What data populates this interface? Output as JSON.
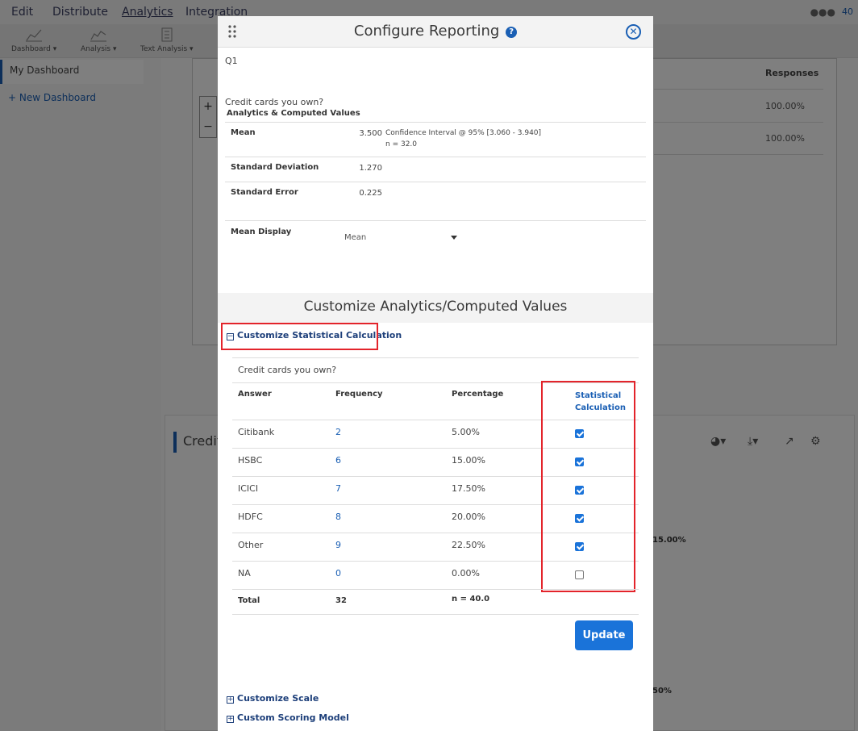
{
  "topnav": {
    "items": [
      "Edit",
      "Distribute",
      "Analytics",
      "Integration"
    ],
    "user_count": "40"
  },
  "toolbar": {
    "tools": [
      "Dashboard",
      "Analysis",
      "Text Analysis"
    ]
  },
  "sidebar": {
    "dashboard": "My Dashboard",
    "new_dashboard": "New Dashboard"
  },
  "background": {
    "responses_header": "Responses",
    "response_values": [
      "100.00%",
      "100.00%"
    ],
    "card_title": "Credit",
    "chart_labels": [
      "15.00%",
      "50%"
    ]
  },
  "modal": {
    "title": "Configure Reporting",
    "question_id": "Q1",
    "question_text": "Credit cards you own?",
    "section_label": "Analytics & Computed Values",
    "stats": {
      "mean_label": "Mean",
      "mean_value": "3.500",
      "confidence": "Confidence Interval @ 95% [3.060 - 3.940]",
      "n": "n = 32.0",
      "sd_label": "Standard Deviation",
      "sd_value": "1.270",
      "se_label": "Standard Error",
      "se_value": "0.225",
      "mean_display_label": "Mean Display",
      "mean_display_value": "Mean"
    },
    "customize_title": "Customize Analytics/Computed Values",
    "customize_stat_calc": "Customize Statistical Calculation",
    "table": {
      "question": "Credit cards you own?",
      "headers": {
        "answer": "Answer",
        "frequency": "Frequency",
        "percentage": "Percentage",
        "stat_calc_1": "Statistical",
        "stat_calc_2": "Calculation"
      },
      "rows": [
        {
          "answer": "Citibank",
          "frequency": "2",
          "percentage": "5.00%",
          "checked": true
        },
        {
          "answer": "HSBC",
          "frequency": "6",
          "percentage": "15.00%",
          "checked": true
        },
        {
          "answer": "ICICI",
          "frequency": "7",
          "percentage": "17.50%",
          "checked": true
        },
        {
          "answer": "HDFC",
          "frequency": "8",
          "percentage": "20.00%",
          "checked": true
        },
        {
          "answer": "Other",
          "frequency": "9",
          "percentage": "22.50%",
          "checked": true
        },
        {
          "answer": "NA",
          "frequency": "0",
          "percentage": "0.00%",
          "checked": false
        }
      ],
      "total": {
        "label": "Total",
        "frequency": "32",
        "n": "n = 40.0"
      }
    },
    "update_label": "Update",
    "customize_scale": "Customize Scale",
    "custom_scoring": "Custom Scoring Model"
  },
  "colors": {
    "accent": "#1a73d9",
    "link": "#1a5fb4",
    "highlight_box": "#e3242b"
  }
}
